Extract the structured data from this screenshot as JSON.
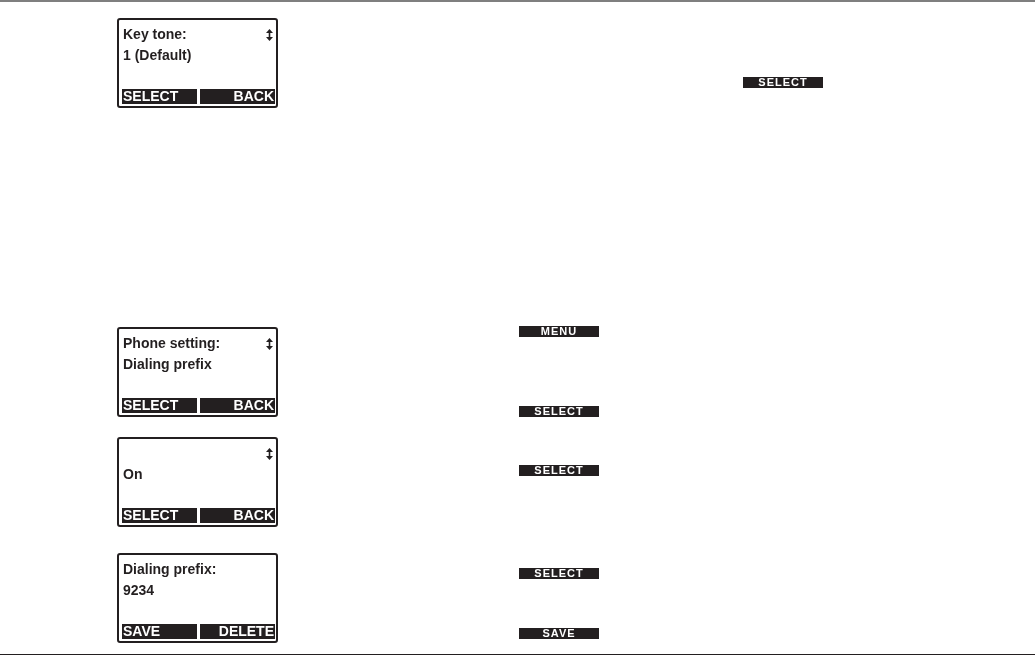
{
  "screens": [
    {
      "title": "Key tone:",
      "value": "1 (Default)",
      "scroll_arrow": true,
      "softkeys": [
        "SELECT",
        "BACK"
      ]
    },
    {
      "title": "Phone setting:",
      "value": "Dialing prefix",
      "scroll_arrow": true,
      "softkeys": [
        "SELECT",
        "BACK"
      ]
    },
    {
      "value": "On",
      "scroll_arrow": true,
      "softkeys": [
        "SELECT",
        "BACK"
      ]
    },
    {
      "title": "Dialing prefix:",
      "value": "9234",
      "scroll_arrow": false,
      "softkeys": [
        "SAVE",
        "DELETE"
      ]
    }
  ],
  "key_label_columns": [
    [
      "MENU",
      "SELECT",
      "SELECT",
      "SELECT",
      "SAVE"
    ],
    [
      "SELECT"
    ]
  ]
}
